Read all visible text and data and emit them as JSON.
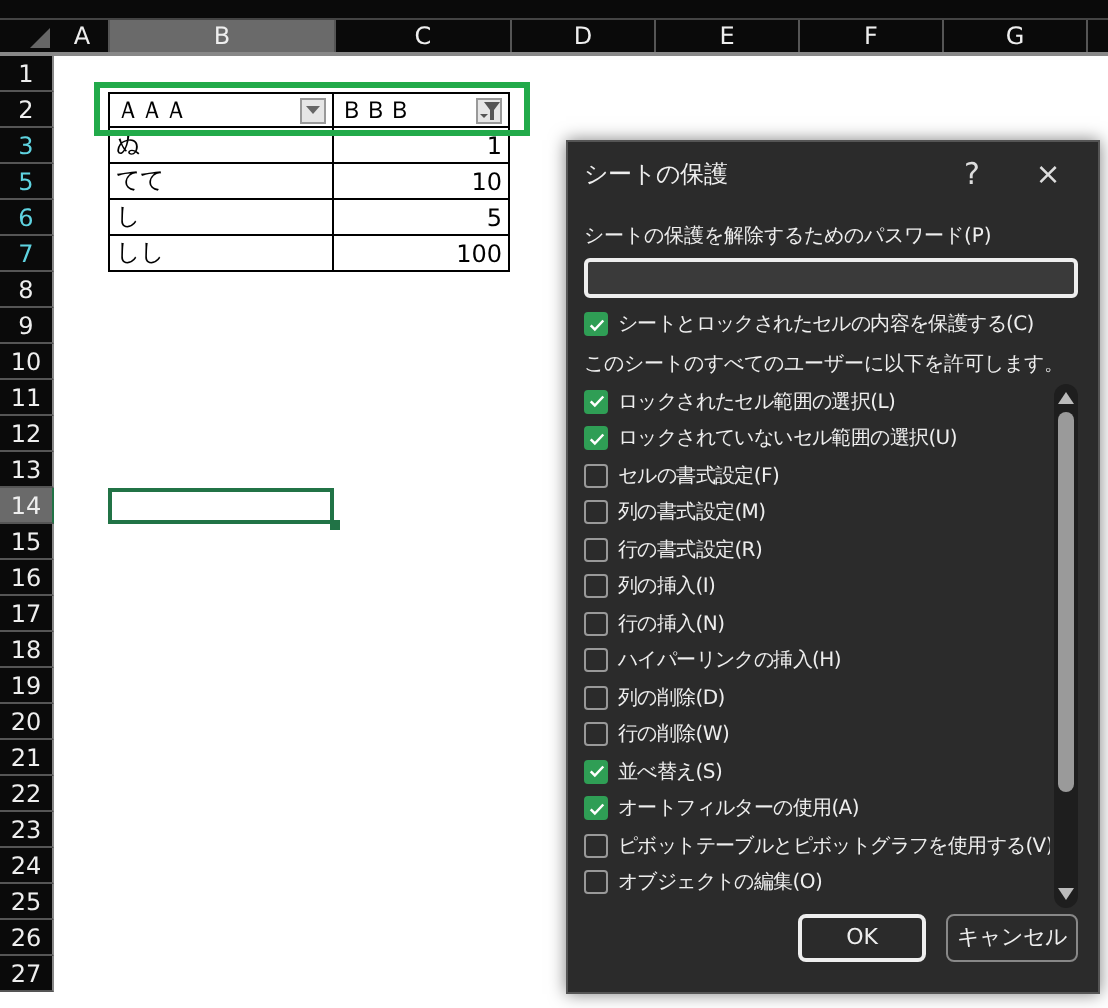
{
  "sheet": {
    "columns": [
      {
        "label": "A",
        "selected": false
      },
      {
        "label": "B",
        "selected": true
      },
      {
        "label": "C",
        "selected": false
      },
      {
        "label": "D",
        "selected": false
      },
      {
        "label": "E",
        "selected": false
      },
      {
        "label": "F",
        "selected": false
      },
      {
        "label": "G",
        "selected": false
      }
    ],
    "rows": [
      {
        "label": "1",
        "selected": false,
        "filtered": false
      },
      {
        "label": "2",
        "selected": false,
        "filtered": false,
        "kind": "header",
        "cells": [
          {
            "text": "ＡＡＡ",
            "filtered": false
          },
          {
            "text": "ＢＢＢ",
            "filtered": true
          }
        ]
      },
      {
        "label": "3",
        "selected": false,
        "filtered": true,
        "kind": "data",
        "cells": [
          {
            "text": "ぬ"
          },
          {
            "text": "1"
          }
        ]
      },
      {
        "label": "5",
        "selected": false,
        "filtered": true,
        "kind": "data",
        "cells": [
          {
            "text": "てて"
          },
          {
            "text": "10"
          }
        ]
      },
      {
        "label": "6",
        "selected": false,
        "filtered": true,
        "kind": "data",
        "cells": [
          {
            "text": "し"
          },
          {
            "text": "5"
          }
        ]
      },
      {
        "label": "7",
        "selected": false,
        "filtered": true,
        "kind": "data",
        "cells": [
          {
            "text": "しし"
          },
          {
            "text": "100"
          }
        ]
      },
      {
        "label": "8",
        "selected": false,
        "filtered": false
      },
      {
        "label": "9",
        "selected": false,
        "filtered": false
      },
      {
        "label": "10",
        "selected": false,
        "filtered": false
      },
      {
        "label": "11",
        "selected": false,
        "filtered": false
      },
      {
        "label": "12",
        "selected": false,
        "filtered": false
      },
      {
        "label": "13",
        "selected": false,
        "filtered": false
      },
      {
        "label": "14",
        "selected": true,
        "filtered": false
      },
      {
        "label": "15",
        "selected": false,
        "filtered": false
      },
      {
        "label": "16",
        "selected": false,
        "filtered": false
      },
      {
        "label": "17",
        "selected": false,
        "filtered": false
      },
      {
        "label": "18",
        "selected": false,
        "filtered": false
      },
      {
        "label": "19",
        "selected": false,
        "filtered": false
      },
      {
        "label": "20",
        "selected": false,
        "filtered": false
      },
      {
        "label": "21",
        "selected": false,
        "filtered": false
      },
      {
        "label": "22",
        "selected": false,
        "filtered": false
      },
      {
        "label": "23",
        "selected": false,
        "filtered": false
      },
      {
        "label": "24",
        "selected": false,
        "filtered": false
      },
      {
        "label": "25",
        "selected": false,
        "filtered": false
      },
      {
        "label": "26",
        "selected": false,
        "filtered": false
      },
      {
        "label": "27",
        "selected": false,
        "filtered": false
      }
    ]
  },
  "dialog": {
    "title": "シートの保護",
    "help": "?",
    "close": "×",
    "password_label": "シートの保護を解除するためのパスワード(P)",
    "protect": {
      "label": "シートとロックされたセルの内容を保護する(C)",
      "checked": true
    },
    "allow_label": "このシートのすべてのユーザーに以下を許可します。",
    "options": [
      {
        "label": "ロックされたセル範囲の選択(L)",
        "checked": true
      },
      {
        "label": "ロックされていないセル範囲の選択(U)",
        "checked": true
      },
      {
        "label": "セルの書式設定(F)",
        "checked": false
      },
      {
        "label": "列の書式設定(M)",
        "checked": false
      },
      {
        "label": "行の書式設定(R)",
        "checked": false
      },
      {
        "label": "列の挿入(I)",
        "checked": false
      },
      {
        "label": "行の挿入(N)",
        "checked": false
      },
      {
        "label": "ハイパーリンクの挿入(H)",
        "checked": false
      },
      {
        "label": "列の削除(D)",
        "checked": false
      },
      {
        "label": "行の削除(W)",
        "checked": false
      },
      {
        "label": "並べ替え(S)",
        "checked": true
      },
      {
        "label": "オートフィルターの使用(A)",
        "checked": true
      },
      {
        "label": "ピボットテーブルとピボットグラフを使用する(V)",
        "checked": false
      },
      {
        "label": "オブジェクトの編集(O)",
        "checked": false
      }
    ],
    "buttons": [
      {
        "label": "OK",
        "default": true
      },
      {
        "label": "キャンセル",
        "default": false
      }
    ]
  }
}
